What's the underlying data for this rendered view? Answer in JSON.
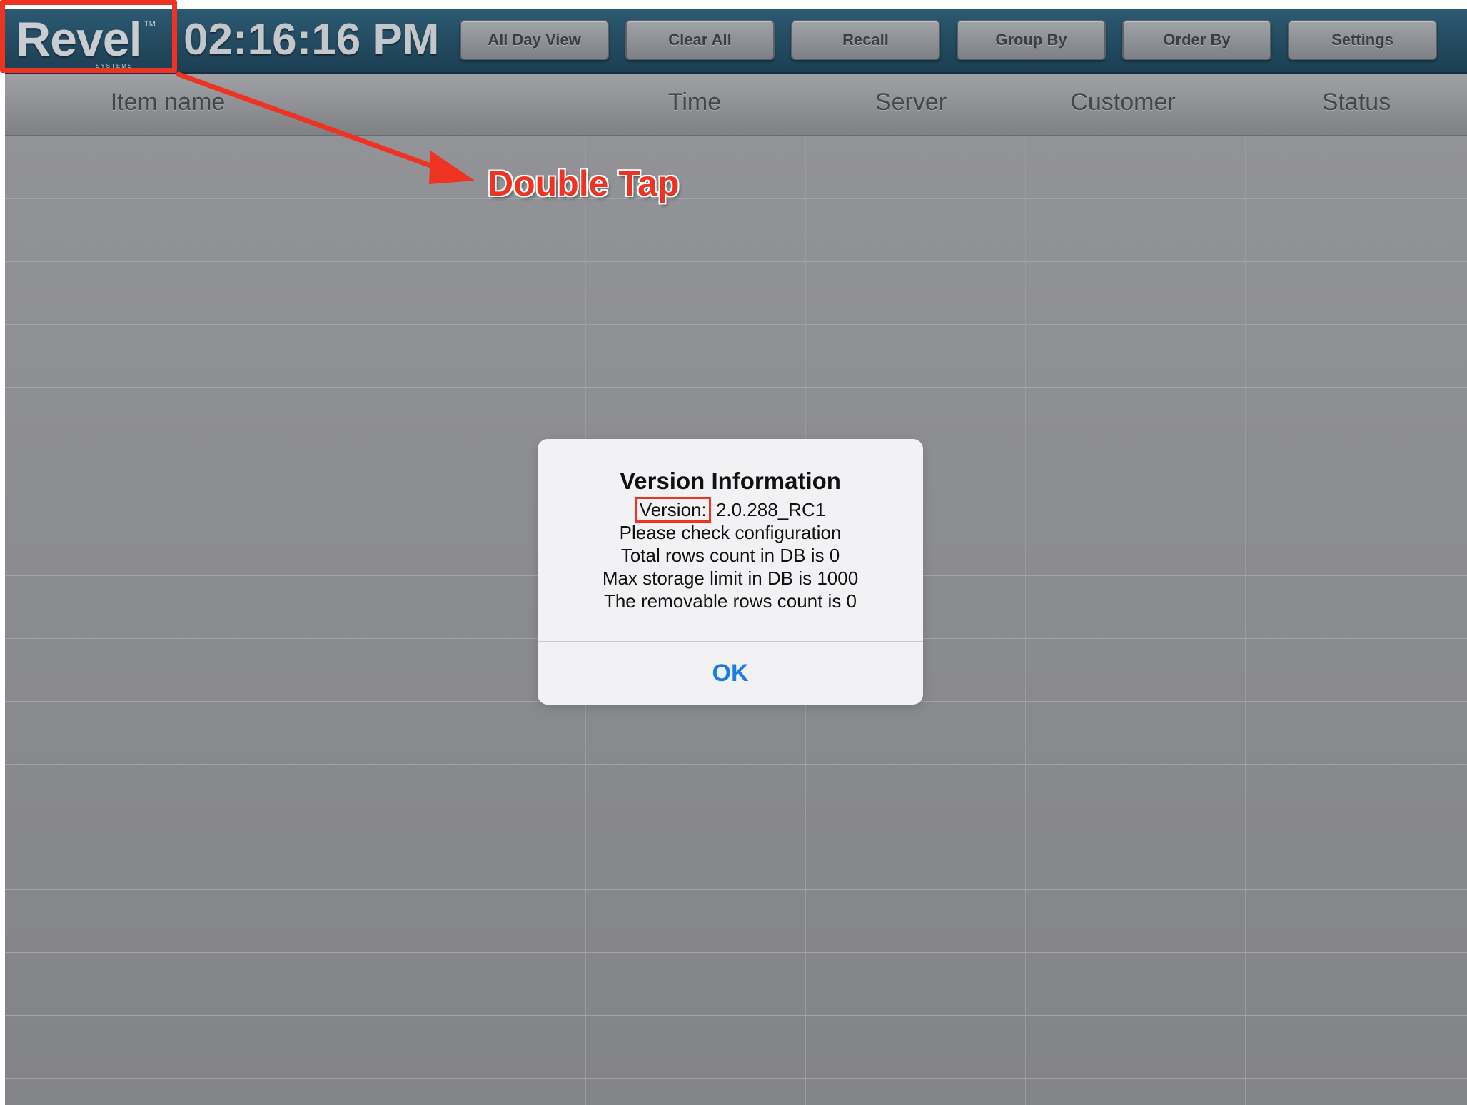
{
  "topbar": {
    "logo": "Revel",
    "logo_tm": "TM",
    "logo_sub": "SYSTEMS",
    "clock": "02:16:16 PM",
    "buttons": [
      "All Day View",
      "Clear All",
      "Recall",
      "Group By",
      "Order By",
      "Settings"
    ]
  },
  "table": {
    "columns": [
      "Item name",
      "Time",
      "Server",
      "Customer",
      "Status"
    ]
  },
  "annotation": {
    "label": "Double Tap",
    "color": "#ee3322"
  },
  "dialog": {
    "title": "Version Information",
    "version_label": "Version:",
    "version_value": "2.0.288_RC1",
    "lines": [
      "Please check configuration",
      "Total rows count in DB is 0",
      "Max storage limit in DB is 1000",
      "The removable rows count is 0"
    ],
    "ok": "OK",
    "ok_color": "#1a7de6"
  }
}
